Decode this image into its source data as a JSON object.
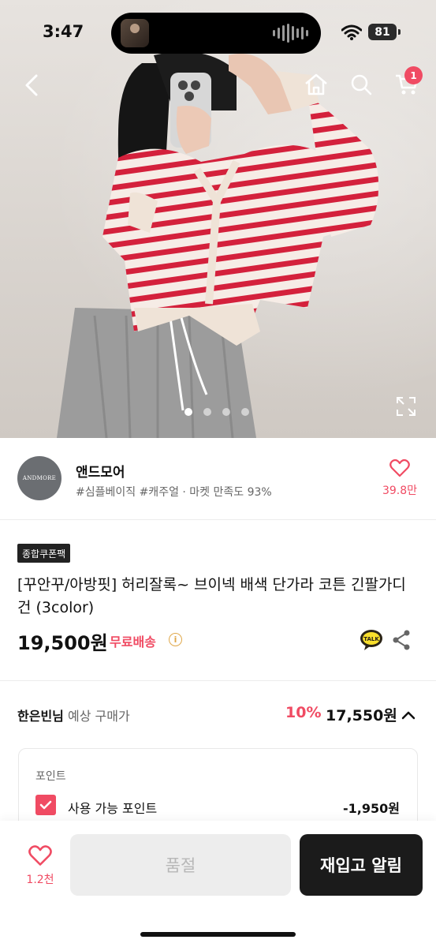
{
  "status_bar": {
    "time": "3:47",
    "battery": "81"
  },
  "cart_badge": "1",
  "shop": {
    "logo_text": "ANDMORE",
    "name": "앤드모어",
    "meta": "#심플베이직 #캐주얼 · 마켓 만족도 93%",
    "likes": "39.8만"
  },
  "product": {
    "badge": "종합쿠폰팩",
    "title": "[꾸안꾸/아방핏] 허리잘록~ 브이넥 배색 단가라 코튼 긴팔가디건 (3color)",
    "price": "19,500원",
    "free_shipping": "무료배송"
  },
  "member_price": {
    "name": "한은빈님",
    "label": "예상 구매가",
    "discount": "10%",
    "final_price": "17,550원"
  },
  "points": {
    "section_label": "포인트",
    "item_label": "사용 가능 포인트",
    "item_value": "-1,950원"
  },
  "bottom_bar": {
    "wish_count": "1.2천",
    "soldout_label": "품절",
    "restock_label": "재입고 알림"
  },
  "carousel": {
    "count": 4,
    "active": 1
  },
  "colors": {
    "accent": "#f04b63",
    "dark": "#1b1b1b"
  }
}
